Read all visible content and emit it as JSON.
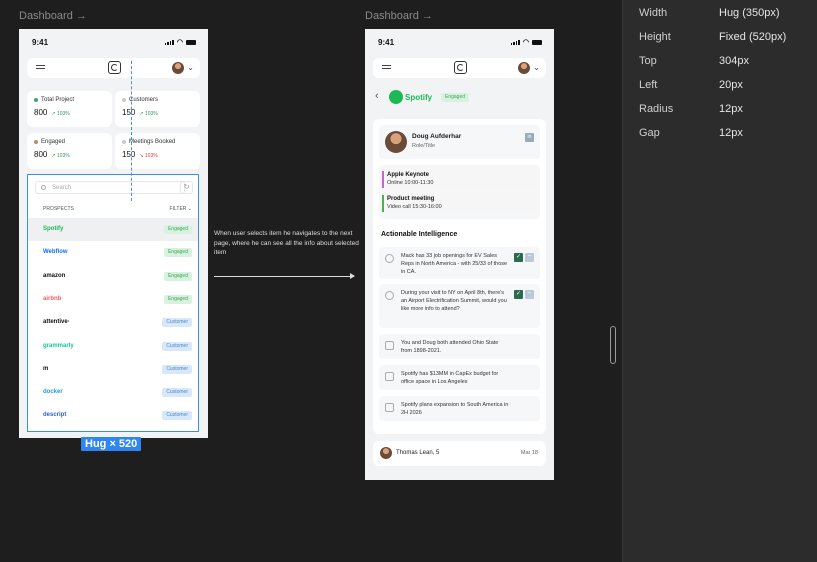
{
  "frames": {
    "left_label": "Dashboard →",
    "right_label": "Dashboard →"
  },
  "status": {
    "time": "9:41"
  },
  "stats": [
    {
      "label": "Total Project",
      "value": "800",
      "delta": "103%",
      "trend": "up",
      "dot": "#3aa867"
    },
    {
      "label": "Customers",
      "value": "150",
      "delta": "103%",
      "trend": "up",
      "dot": "#c9c9c9"
    },
    {
      "label": "Engaged",
      "value": "800",
      "delta": "103%",
      "trend": "up",
      "dot": "#b08f6a"
    },
    {
      "label": "Meetings Booked",
      "value": "150",
      "delta": "103%",
      "trend": "down",
      "dot": "#c9c9c9"
    }
  ],
  "search": {
    "placeholder": "Search"
  },
  "list_header": {
    "left": "PROSPECTS",
    "right": "FILTER"
  },
  "prospects": [
    {
      "name": "Spotify",
      "status": "Engaged",
      "color": "#1db954"
    },
    {
      "name": "Webflow",
      "status": "Engaged",
      "color": "#146ef5"
    },
    {
      "name": "amazon",
      "status": "Engaged",
      "color": "#111111"
    },
    {
      "name": "airbnb",
      "status": "Engaged",
      "color": "#ff5a5f"
    },
    {
      "name": "attentive·",
      "status": "Customer",
      "color": "#111111"
    },
    {
      "name": "grammarly",
      "status": "Customer",
      "color": "#15c39a"
    },
    {
      "name": "m",
      "status": "Customer",
      "color": "#111111"
    },
    {
      "name": "docker",
      "status": "Customer",
      "color": "#2496ed"
    },
    {
      "name": "descript",
      "status": "Customer",
      "color": "#2b5fd9"
    }
  ],
  "hug_badge": "Hug × 520",
  "annotation": "When user selects item he navigates to the next page, where he can see all the info about selected item",
  "detail": {
    "company": "Spotify",
    "company_badge": "Engaged",
    "contact_name": "Doug Aufderhar",
    "contact_role": "Role/Title",
    "meetings": [
      {
        "title": "Apple Keynote",
        "detail": "Online  10:00-11:30",
        "color": "#c26ac9"
      },
      {
        "title": "Product meeting",
        "detail": "Video call  15:30-16:00",
        "color": "#4caf50"
      }
    ],
    "intel_title": "Actionable Intelligence",
    "intel": [
      {
        "text": "Mack has 33 job openings for EV Sales Reps in North America - with 25/33 of those in CA.",
        "actions": true
      },
      {
        "text": "During your visit to NY on April 8th, there's an Airport Electrification Summit, would you like more info to attend?",
        "actions": true
      },
      {
        "text": "You and Doug both attended Ohio State from 1898-2021.",
        "actions": false
      },
      {
        "text": "Spotify has $13MM in CapEx budget for office space in Los Angeles",
        "actions": false
      },
      {
        "text": "Spotify plans expansion to South America in 2H 2026",
        "actions": false
      }
    ],
    "footer_name": "Thomas Lean, 5",
    "footer_date": "Mar 18"
  },
  "properties": [
    {
      "key": "Width",
      "value": "Hug (350px)"
    },
    {
      "key": "Height",
      "value": "Fixed (520px)"
    },
    {
      "key": "Top",
      "value": "304px"
    },
    {
      "key": "Left",
      "value": "20px"
    },
    {
      "key": "Radius",
      "value": "12px"
    },
    {
      "key": "Gap",
      "value": "12px"
    }
  ]
}
